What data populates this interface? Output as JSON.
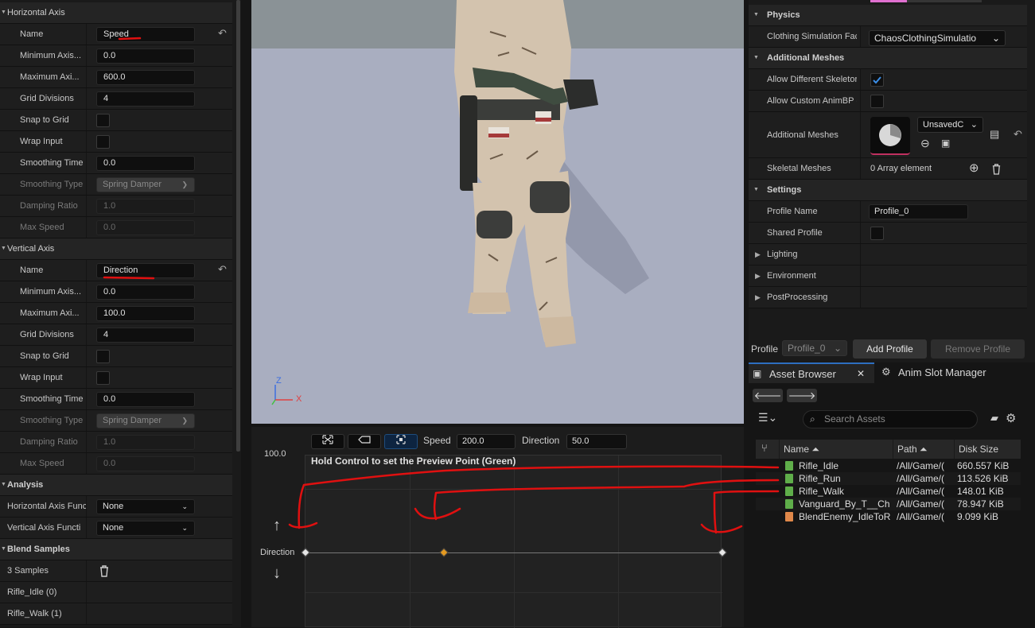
{
  "left_panel": {
    "horizontal_axis": {
      "title": "Horizontal Axis",
      "name_label": "Name",
      "name_value": "Speed",
      "min_label": "Minimum Axis...",
      "min_value": "0.0",
      "max_label": "Maximum Axi...",
      "max_value": "600.0",
      "grid_label": "Grid Divisions",
      "grid_value": "4",
      "snap_label": "Snap to Grid",
      "wrap_label": "Wrap Input",
      "smoothing_time_label": "Smoothing Time",
      "smoothing_time_value": "0.0",
      "smoothing_type_label": "Smoothing Type",
      "smoothing_type_value": "Spring Damper",
      "damping_label": "Damping Ratio",
      "damping_value": "1.0",
      "max_speed_label": "Max Speed",
      "max_speed_value": "0.0"
    },
    "vertical_axis": {
      "title": "Vertical Axis",
      "name_label": "Name",
      "name_value": "Direction",
      "min_label": "Minimum Axis...",
      "min_value": "0.0",
      "max_label": "Maximum Axi...",
      "max_value": "100.0",
      "grid_label": "Grid Divisions",
      "grid_value": "4",
      "snap_label": "Snap to Grid",
      "wrap_label": "Wrap Input",
      "smoothing_time_label": "Smoothing Time",
      "smoothing_time_value": "0.0",
      "smoothing_type_label": "Smoothing Type",
      "smoothing_type_value": "Spring Damper",
      "damping_label": "Damping Ratio",
      "damping_value": "1.0",
      "max_speed_label": "Max Speed",
      "max_speed_value": "0.0"
    },
    "analysis": {
      "title": "Analysis",
      "h_func_label": "Horizontal Axis Func",
      "h_func_value": "None",
      "v_func_label": "Vertical Axis Functi",
      "v_func_value": "None"
    },
    "blend_samples": {
      "title": "Blend Samples",
      "count": "3 Samples",
      "items": [
        "Rifle_Idle (0)",
        "Rifle_Walk (1)"
      ]
    }
  },
  "blendspace": {
    "speed_label": "Speed",
    "speed_value": "200.0",
    "direction_label": "Direction",
    "direction_value": "50.0",
    "y_max": "100.0",
    "hint": "Hold Control to set the Preview Point (Green)",
    "axis_label": "Direction",
    "up_arrow": "↑",
    "down_arrow": "↓",
    "sample_positions": [
      0,
      0.333,
      1
    ]
  },
  "viewport": {
    "gizmo_z": "Z",
    "gizmo_x": "X"
  },
  "right_panel": {
    "physics": {
      "title": "Physics",
      "clothing_label": "Clothing Simulation Fac",
      "clothing_value": "ChaosClothingSimulatio"
    },
    "additional_meshes": {
      "title": "Additional Meshes",
      "allow_diff_label": "Allow Different Skeletor",
      "allow_custom_label": "Allow Custom AnimBP (",
      "meshes_label": "Additional Meshes",
      "meshes_value": "UnsavedC",
      "skeletal_label": "Skeletal Meshes",
      "skeletal_value": "0 Array element"
    },
    "settings": {
      "title": "Settings",
      "profile_name_label": "Profile Name",
      "profile_name_value": "Profile_0",
      "shared_label": "Shared Profile",
      "lighting": "Lighting",
      "environment": "Environment",
      "postprocessing": "PostProcessing"
    },
    "profile_label": "Profile",
    "profile_value": "Profile_0",
    "add_profile": "Add Profile",
    "remove_profile": "Remove Profile"
  },
  "asset_browser": {
    "tab1": "Asset Browser",
    "tab2": "Anim Slot Manager",
    "search_placeholder": "Search Assets",
    "columns": {
      "name": "Name",
      "path": "Path",
      "size": "Disk Size"
    },
    "rows": [
      {
        "name": "Rifle_Idle",
        "path": "/All/Game/(",
        "size": "660.557 KiB",
        "color": "#5fae4a"
      },
      {
        "name": "Rifle_Run",
        "path": "/All/Game/(",
        "size": "113.526 KiB",
        "color": "#5fae4a"
      },
      {
        "name": "Rifle_Walk",
        "path": "/All/Game/(",
        "size": "148.01 KiB",
        "color": "#5fae4a"
      },
      {
        "name": "Vanguard_By_T__Ch",
        "path": "/All/Game/(",
        "size": "78.947 KiB",
        "color": "#5fae4a"
      },
      {
        "name": "BlendEnemy_IdleToR",
        "path": "/All/Game/(",
        "size": "9.099 KiB",
        "color": "#e0884a"
      }
    ]
  },
  "colors": {
    "accent": "#1e4d7e",
    "annotation": "#e01010",
    "selected_point": "#e49a20"
  }
}
